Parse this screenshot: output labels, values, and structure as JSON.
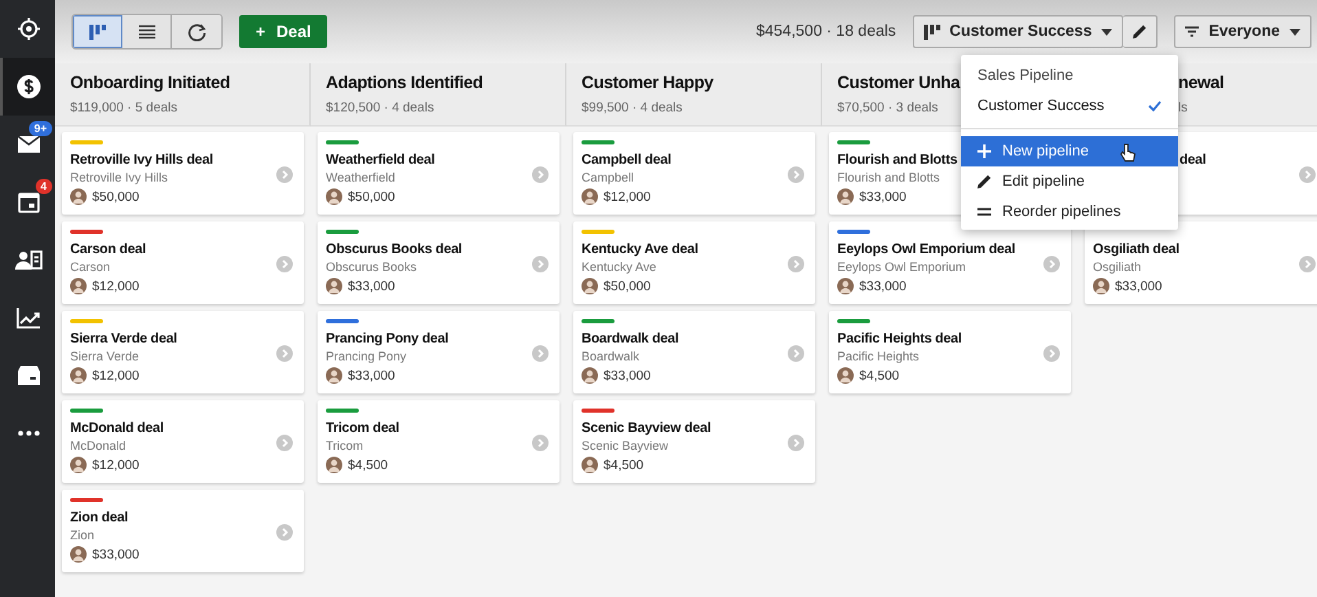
{
  "sidebar": {
    "items": [
      {
        "selected": false
      },
      {
        "selected": true
      },
      {
        "selected": false,
        "badge": "9+",
        "color": "#2f6fdc"
      },
      {
        "selected": false,
        "badge": "4",
        "color": "#e0322a"
      },
      {
        "selected": false
      },
      {
        "selected": false
      },
      {
        "selected": false
      },
      {
        "selected": false
      }
    ]
  },
  "toolbar": {
    "views": [
      {
        "selected": true
      },
      {
        "selected": false
      },
      {
        "selected": false
      }
    ],
    "add_button": {
      "icon": "+",
      "label": "Deal"
    },
    "summary": "$454,500 · 18 deals",
    "pipeline_select": "Customer Success",
    "filter_select": "Everyone"
  },
  "pipeline_menu": {
    "pipelines": [
      {
        "label": "Sales Pipeline",
        "selected": false
      },
      {
        "label": "Customer Success",
        "selected": true
      }
    ],
    "actions": [
      {
        "label": "New pipeline",
        "highlighted": true
      },
      {
        "label": "Edit pipeline",
        "highlighted": false
      },
      {
        "label": "Reorder pipelines",
        "highlighted": false
      }
    ]
  },
  "columns": [
    {
      "title": "Onboarding Initiated",
      "summary": "$119,000 · 5 deals",
      "deals": [
        {
          "title": "Retroville Ivy Hills deal",
          "org": "Retroville Ivy Hills",
          "amount": "$50,000",
          "color": "#f2c200"
        },
        {
          "title": "Carson deal",
          "org": "Carson",
          "amount": "$12,000",
          "color": "#e0322a"
        },
        {
          "title": "Sierra Verde deal",
          "org": "Sierra Verde",
          "amount": "$12,000",
          "color": "#f2c200"
        },
        {
          "title": "McDonald deal",
          "org": "McDonald",
          "amount": "$12,000",
          "color": "#1a9c3e"
        },
        {
          "title": "Zion deal",
          "org": "Zion",
          "amount": "$33,000",
          "color": "#e0322a"
        }
      ]
    },
    {
      "title": "Adaptions Identified",
      "summary": "$120,500 · 4 deals",
      "deals": [
        {
          "title": "Weatherfield deal",
          "org": "Weatherfield",
          "amount": "$50,000",
          "color": "#1a9c3e"
        },
        {
          "title": "Obscurus Books deal",
          "org": "Obscurus Books",
          "amount": "$33,000",
          "color": "#1a9c3e"
        },
        {
          "title": "Prancing Pony deal",
          "org": "Prancing Pony",
          "amount": "$33,000",
          "color": "#2f6fdc"
        },
        {
          "title": "Tricom deal",
          "org": "Tricom",
          "amount": "$4,500",
          "color": "#1a9c3e"
        }
      ]
    },
    {
      "title": "Customer Happy",
      "summary": "$99,500 · 4 deals",
      "deals": [
        {
          "title": "Campbell deal",
          "org": "Campbell",
          "amount": "$12,000",
          "color": "#1a9c3e"
        },
        {
          "title": "Kentucky Ave deal",
          "org": "Kentucky Ave",
          "amount": "$50,000",
          "color": "#f2c200"
        },
        {
          "title": "Boardwalk deal",
          "org": "Boardwalk",
          "amount": "$33,000",
          "color": "#1a9c3e"
        },
        {
          "title": "Scenic Bayview deal",
          "org": "Scenic Bayview",
          "amount": "$4,500",
          "color": "#e0322a"
        }
      ]
    },
    {
      "title": "Customer Unha",
      "summary": "$70,500 · 3 deals",
      "deals": [
        {
          "title": "Flourish and Blotts",
          "org": "Flourish and Blotts",
          "amount": "$33,000",
          "color": "#1a9c3e"
        },
        {
          "title": "Eeylops Owl Emporium deal",
          "org": "Eeylops Owl Emporium",
          "amount": "$33,000",
          "color": "#2f6fdc"
        },
        {
          "title": "Pacific Heights deal",
          "org": "Pacific Heights",
          "amount": "$4,500",
          "color": "#1a9c3e"
        }
      ]
    },
    {
      "title": "newal",
      "summary": "ls",
      "deals": [
        {
          "title": "deal"
        },
        {
          "title": "Osgiliath deal",
          "org": "Osgiliath",
          "amount": "$33,000"
        }
      ]
    }
  ]
}
